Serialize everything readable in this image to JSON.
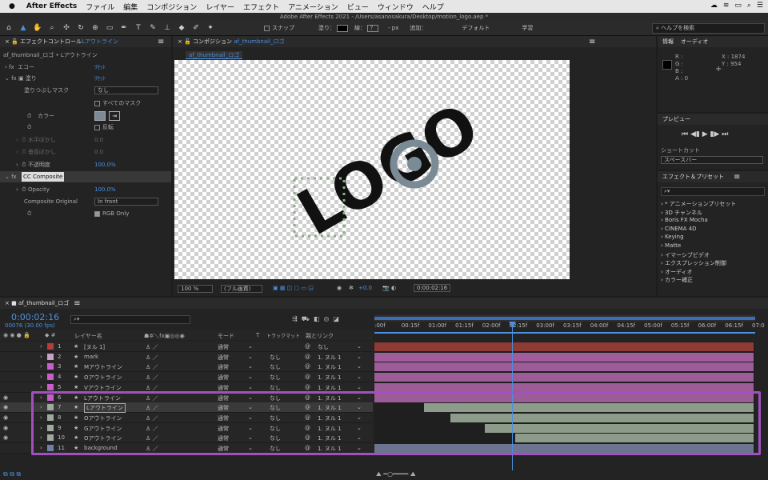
{
  "menubar": {
    "app": "After Effects",
    "items": [
      "ファイル",
      "編集",
      "コンポジション",
      "レイヤー",
      "エフェクト",
      "アニメーション",
      "ビュー",
      "ウィンドウ",
      "ヘルプ"
    ]
  },
  "titlebar": {
    "title": "Adobe After Effects 2021 - /Users/asanosakura/Desktop/motion_logo.aep *"
  },
  "toolbar": {
    "snap": "スナップ",
    "fill": "塗り：",
    "stroke": "線：",
    "stroke_value": "？",
    "px": "- px",
    "add": "追加：",
    "workspace1": "デフォルト",
    "workspace2": "学習",
    "search_placeholder": "ヘルプを検索"
  },
  "effects_panel": {
    "tab": "エフェクトコントロール",
    "tab_layer": "Lアウトライン",
    "path": "af_thumbnail_ロゴ • Lアウトライン",
    "rows": {
      "echo": "エコー",
      "reset": "ﾘｾｯﾄ",
      "fill": "塗り",
      "mask_label": "塗りつぶしマスク",
      "mask_value": "なし",
      "all_masks": "すべてのマスク",
      "color": "カラー",
      "invert": "反転",
      "h_feather": "水平ぼかし",
      "h_val": "0.0",
      "v_feather": "垂直ぼかし",
      "v_val": "0.0",
      "opacity": "不透明度",
      "opacity_val": "100.0%",
      "cc": "CC Composite",
      "cc_opacity": "Opacity",
      "cc_opacity_val": "100.0%",
      "comp_orig": "Composite Original",
      "comp_orig_val": "In front",
      "rgb_only": "RGB Only"
    }
  },
  "comp_panel": {
    "tab": "コンポジション",
    "comp_name": "af_thumbnail_ロゴ",
    "chip": "af_thumbnail_ロゴ",
    "zoom": "100 %",
    "quality": "(フル画質)",
    "exposure": "+0.0",
    "time": "0:00:02:16",
    "logo_text": "LOGO"
  },
  "info_panel": {
    "tab": "情報",
    "tab2": "オーディオ",
    "r": "R :",
    "g": "G :",
    "b": "B :",
    "a": "A : 0",
    "x": "X : 1874",
    "y": "Y : 954"
  },
  "preview_panel": {
    "tab": "プレビュー",
    "shortcut": "ショートカット",
    "shortcut_value": "スペースバー"
  },
  "presets_panel": {
    "tab": "エフェクト＆プリセット",
    "items": [
      "* アニメーションプリセット",
      "3D チャンネル",
      "Boris FX Mocha",
      "CINEMA 4D",
      "Keying",
      "Matte",
      "イマーシブビデオ",
      "エクスプレッション制御",
      "オーディオ",
      "カラー補正"
    ]
  },
  "timeline": {
    "tab": "af_thumbnail_ロゴ",
    "timecode": "0:00:02:16",
    "frames": "00076 (30.00 fps)",
    "col_name": "レイヤー名",
    "col_mode": "モード",
    "col_t": "T",
    "col_track": "トラックマット",
    "col_parent": "親とリンク",
    "ruler": [
      ":00f",
      "00:15f",
      "01:00f",
      "01:15f",
      "02:00f",
      "02:15f",
      "03:00f",
      "03:15f",
      "04:00f",
      "04:15f",
      "05:00f",
      "05:15f",
      "06:00f",
      "06:15f",
      "07:0"
    ],
    "layers": [
      {
        "num": "1",
        "name": "[ヌル 1]",
        "mode": "通常",
        "track": "",
        "parent": "なし",
        "color": "#b33c3c",
        "bar": "#8e3a35",
        "start": 0.0
      },
      {
        "num": "2",
        "name": "mark",
        "mode": "通常",
        "track": "なし",
        "parent": "1. ヌル 1",
        "color": "#c8a0c8",
        "bar": "#a05c9c",
        "start": 0.0
      },
      {
        "num": "3",
        "name": "Mアウトライン",
        "mode": "通常",
        "track": "なし",
        "parent": "1. ヌル 1",
        "color": "#c85fc8",
        "bar": "#9c5c98",
        "start": 0.0
      },
      {
        "num": "4",
        "name": "Oアウトライン",
        "mode": "通常",
        "track": "なし",
        "parent": "1. ヌル 1",
        "color": "#c85fc8",
        "bar": "#9c5c98",
        "start": 0.0
      },
      {
        "num": "5",
        "name": "Vアウトライン",
        "mode": "通常",
        "track": "なし",
        "parent": "1. ヌル 1",
        "color": "#c85fc8",
        "bar": "#9c5c98",
        "start": 0.0
      },
      {
        "num": "6",
        "name": "Lアウトライン",
        "mode": "通常",
        "track": "なし",
        "parent": "1. ヌル 1",
        "color": "#c85fc8",
        "bar": "#9c5c98",
        "start": 0.0
      },
      {
        "num": "7",
        "name": "Lアウトライン",
        "mode": "通常",
        "track": "なし",
        "parent": "1. ヌル 1",
        "color": "#a0a8a0",
        "bar": "#8d9c8a",
        "start": 0.13
      },
      {
        "num": "8",
        "name": "Oアウトライン",
        "mode": "通常",
        "track": "なし",
        "parent": "1. ヌル 1",
        "color": "#a0a8a0",
        "bar": "#8d9c8a",
        "start": 0.2
      },
      {
        "num": "9",
        "name": "Gアウトライン",
        "mode": "通常",
        "track": "なし",
        "parent": "1. ヌル 1",
        "color": "#a0a8a0",
        "bar": "#8d9c8a",
        "start": 0.29
      },
      {
        "num": "10",
        "name": "Oアウトライン",
        "mode": "通常",
        "track": "なし",
        "parent": "1. ヌル 1",
        "color": "#a0a8a0",
        "bar": "#8d9c8a",
        "start": 0.37
      },
      {
        "num": "11",
        "name": "background",
        "mode": "通常",
        "track": "なし",
        "parent": "1. ヌル 1",
        "color": "#7080a8",
        "bar": "#6c7490",
        "start": 0.0
      }
    ]
  }
}
